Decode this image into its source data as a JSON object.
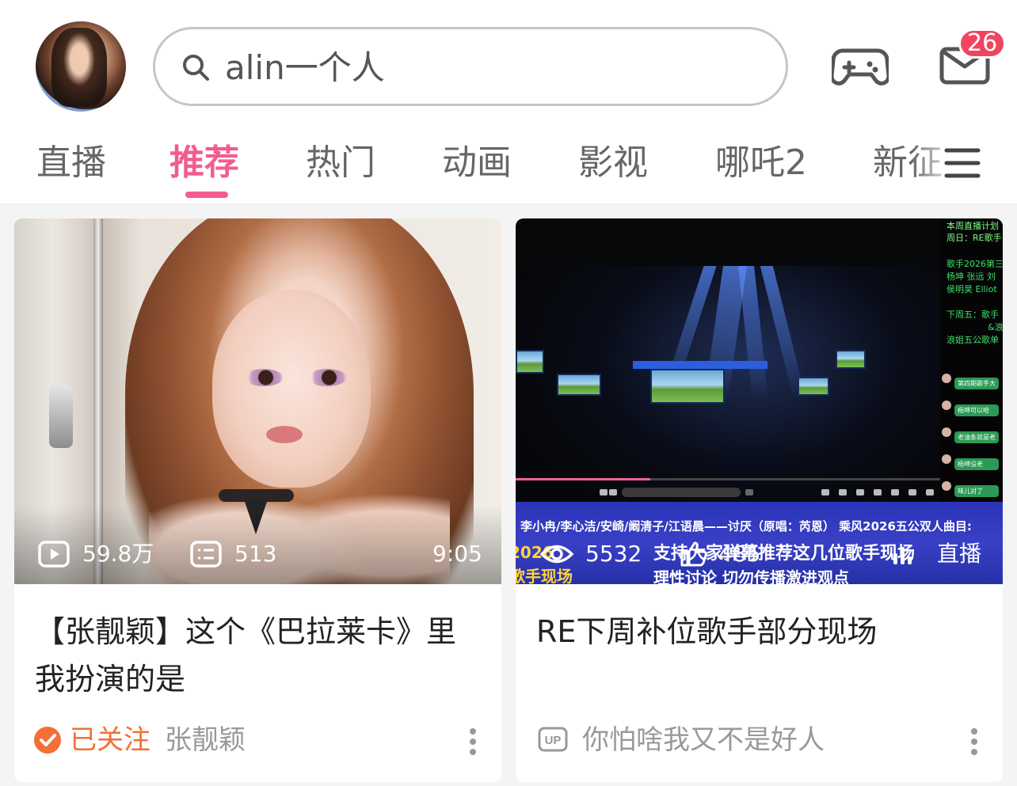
{
  "header": {
    "search_text": "alin一个人",
    "badge_count": "26",
    "icons": {
      "search": "search-icon",
      "game": "gamepad-icon",
      "mail": "mail-icon"
    }
  },
  "tabs": [
    {
      "label": "直播",
      "active": false
    },
    {
      "label": "推荐",
      "active": true
    },
    {
      "label": "热门",
      "active": false
    },
    {
      "label": "动画",
      "active": false
    },
    {
      "label": "影视",
      "active": false
    },
    {
      "label": "哪吒2",
      "active": false
    },
    {
      "label": "新征",
      "active": false
    }
  ],
  "colors": {
    "accent": "#f25d8e",
    "followed": "#f36f35",
    "badge": "#f0455e"
  },
  "cards": [
    {
      "views": "59.8万",
      "comments": "513",
      "duration": "9:05",
      "title": "【张靓颖】这个《巴拉莱卡》里我扮演的是",
      "followed_label": "已关注",
      "author": "张靓颖"
    },
    {
      "viewers": "5532",
      "overlay_text": "支持大家弹幕推荐这几位歌手现场",
      "likes": "485",
      "live_label": "直播",
      "title": "RE下周补位歌手部分现场",
      "uploader": "你怕啥我又不是好人",
      "banner": {
        "line1": "李小冉/李心洁/安崎/阚清子/江语晨——讨厌（原唱：芮恩）  乘风2026五公双人曲目:",
        "line2": "理性讨论 切勿传播激进观点",
        "year": "2026",
        "sub": "歌手现场"
      },
      "side_panel": [
        "本周直播计划",
        "周日：RE歌手",
        "歌手2026第三",
        "杨坤 张远 刘",
        "侯明昊 Elliot",
        "下周五：歌手",
        "&浪",
        "浪姐五公歌单"
      ],
      "chat": [
        "第四期歌手大",
        "杨坤可以哈",
        "老油条就是老",
        "杨坤没老",
        "味儿对了"
      ]
    }
  ]
}
